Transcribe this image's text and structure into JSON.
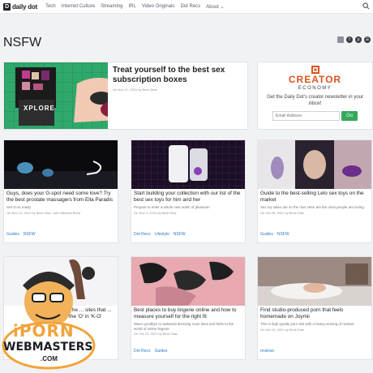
{
  "header": {
    "logo_text": "daily dot",
    "logo_mark": "D",
    "nav": [
      "Tech",
      "Internet Culture",
      "Streaming",
      "IRL",
      "Video Originals",
      "Dot Recs",
      "About ⌄"
    ]
  },
  "page_title": "NSFW",
  "social": [
    "share",
    "f",
    "p",
    "☰"
  ],
  "featured": {
    "title": "Treat yourself to the best sex subscription boxes",
    "meta": "On Nov 17, 2021 by Beck Diaz",
    "image_text": "XPLORE"
  },
  "creator_box": {
    "logo_line1": "CREATOR",
    "logo_line2": "ECONOMY",
    "description": "Get the Daily Dot's creator newsletter in your inbox!",
    "email_placeholder": "Email Address",
    "button": "Go"
  },
  "posts": [
    {
      "title": "Guys, does your G-spot need some love? Try the best prostate massagers from Ella Paradis",
      "excerpt": "Get G-ss ready",
      "meta": "On Nov 13, 2021 by Beck Diaz, John-Michael Bond",
      "tags": [
        "Guides",
        "NSFW"
      ]
    },
    {
      "title": "Start building your collection with our list of the best sex toys for him and her",
      "excerpt": "Prepare to enter a whole new realm of pleasure!",
      "meta": "On Nov 4, 2021 by Beck Diaz",
      "tags": [
        "Dot Recs",
        "Lifestyle",
        "NSFW"
      ]
    },
    {
      "title": "Guide to the best-selling Lelo sex toys on the market",
      "excerpt": "Sex toy sales are on the rise! Here are the ones people are loving.",
      "meta": "On Oct 28, 2021 by Beck Diaz",
      "tags": [
        "Guides",
        "NSFW"
      ]
    },
    {
      "title": "The ... sites that ... the 'O' in 'K-O'",
      "excerpt": "",
      "meta": "",
      "tags": []
    },
    {
      "title": "Best places to buy lingerie online and how to measure yourself for the right fit",
      "excerpt": "Wave goodbye to awkward dressing room lines and hello to the world of online lingerie",
      "meta": "On Oct 13, 2021 by Beck Diaz",
      "tags": [
        "Dot Recs",
        "Guides"
      ]
    },
    {
      "title": "Find studio-produced porn that feels homemade on Joymii",
      "excerpt": "This is high quality porn site with a heavy serving of realism.",
      "meta": "On Oct 15, 2021 by Beck Diaz",
      "tags": [
        "reviews"
      ]
    }
  ],
  "badge": {
    "line1": "iPORN",
    "line2": "WEBMASTERS",
    "line3": ".COM"
  },
  "colors": {
    "accent": "#2d79c7",
    "creator_orange": "#d9531e",
    "go_green": "#35a85c",
    "featured_bg": "#2fa86b"
  }
}
